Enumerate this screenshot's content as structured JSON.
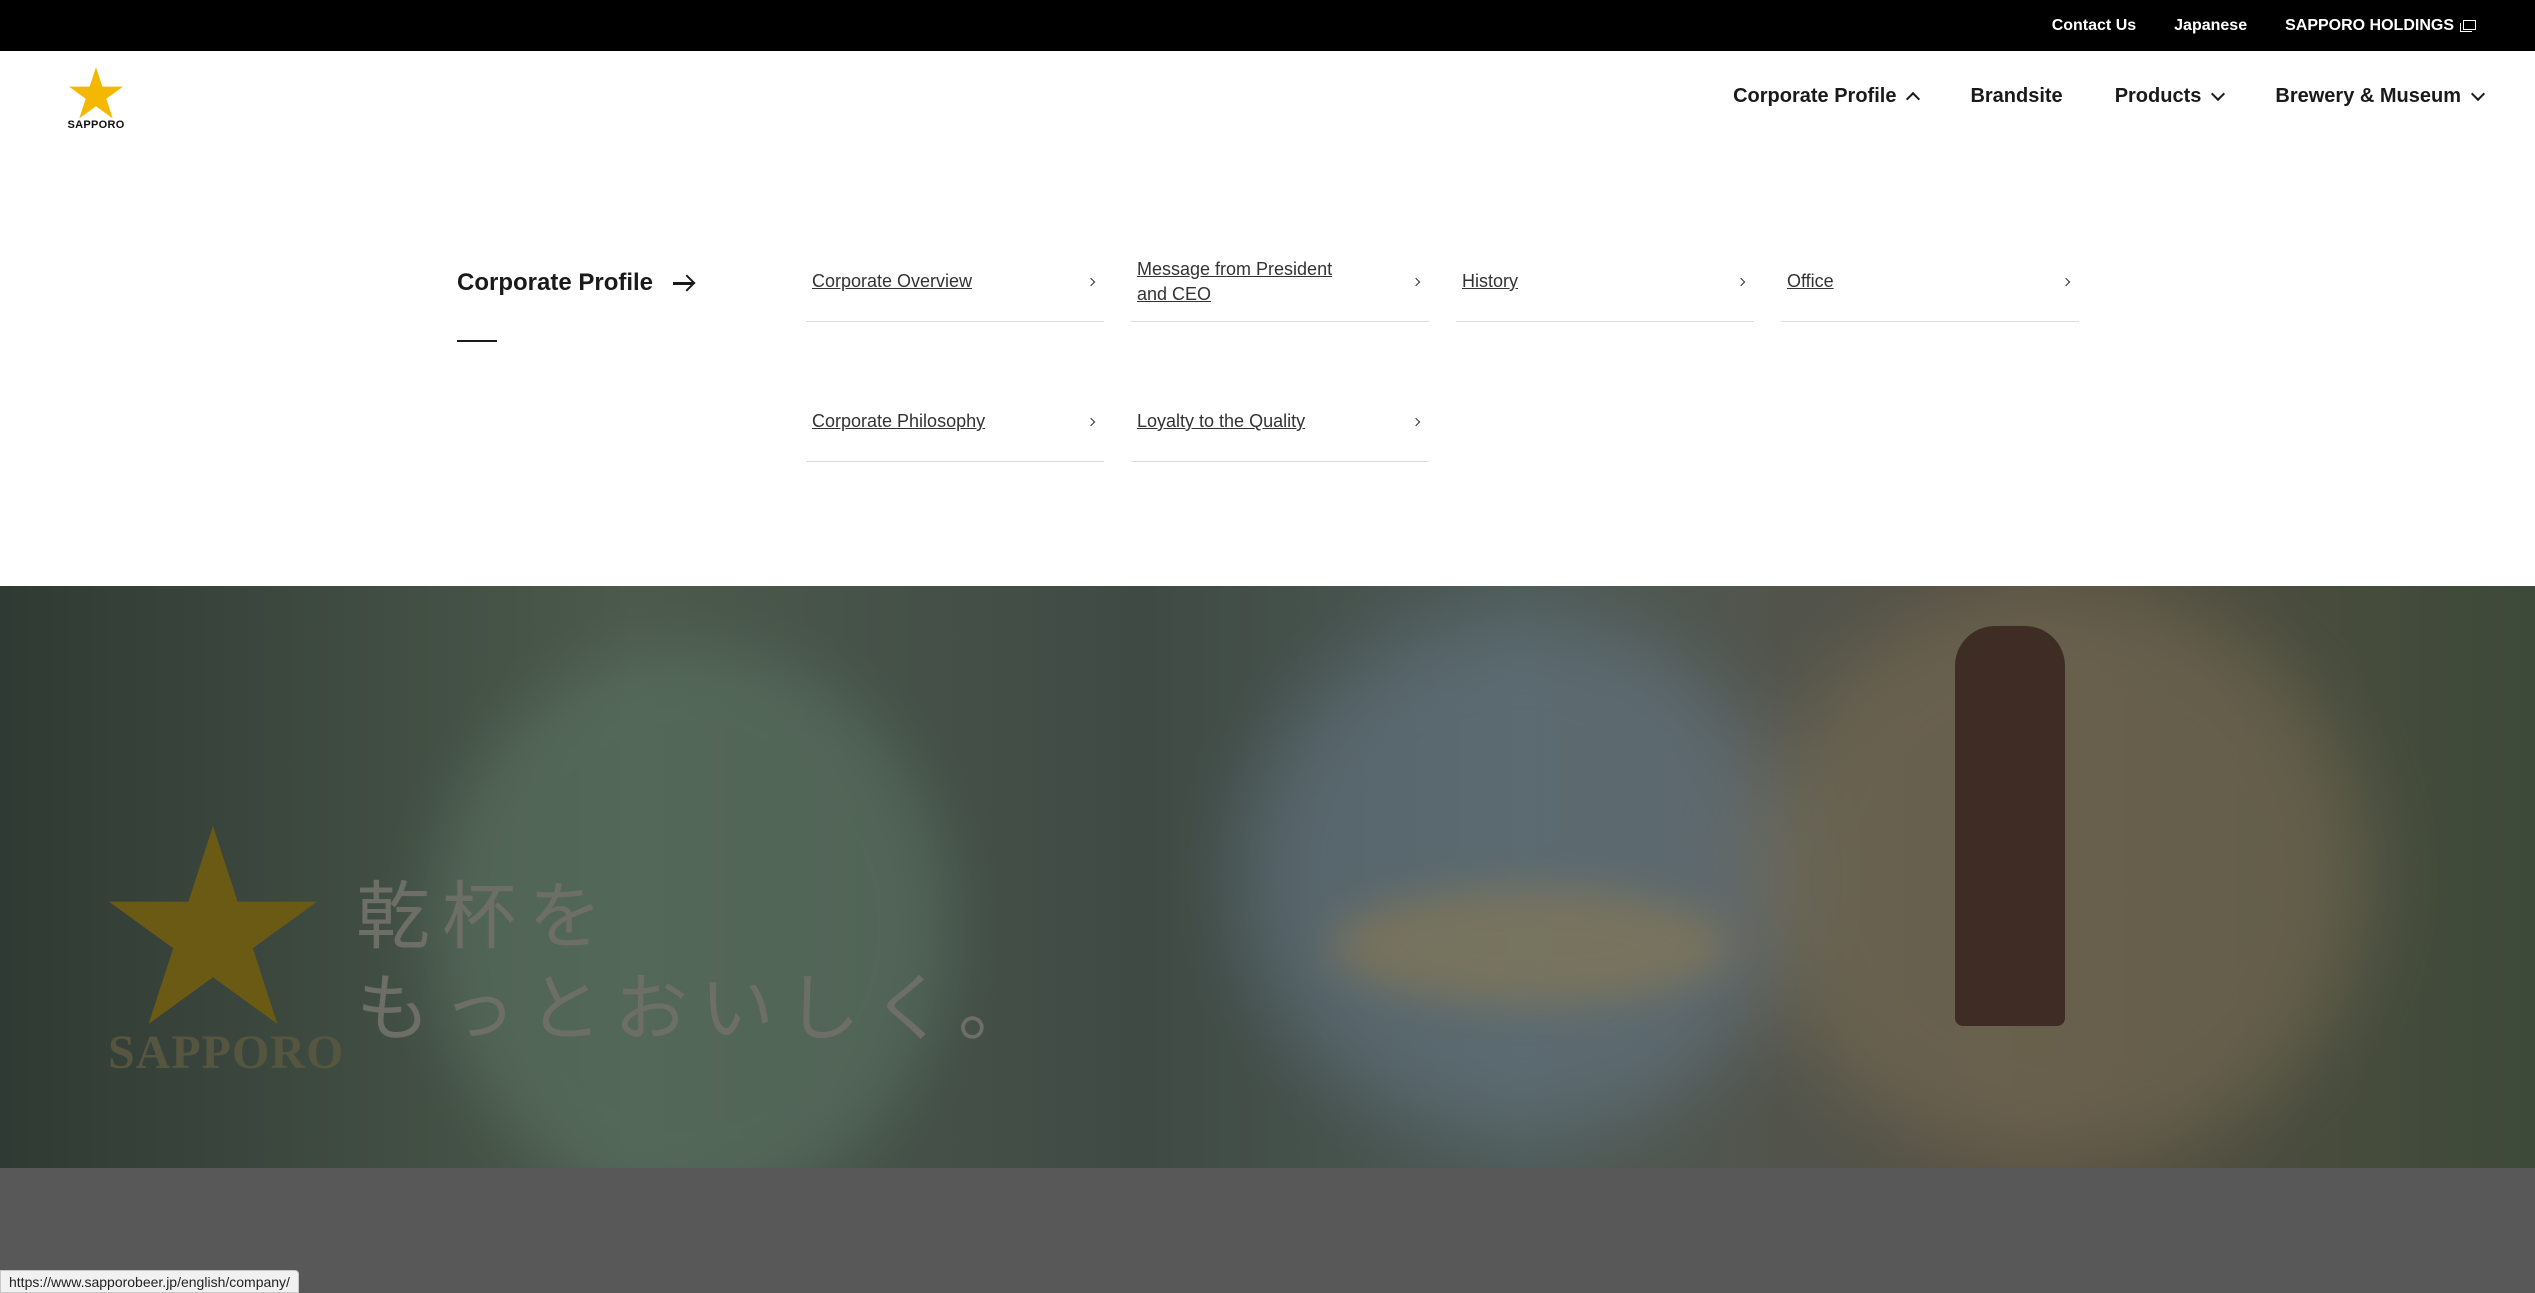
{
  "utility": {
    "contact": "Contact Us",
    "language": "Japanese",
    "holdings": "SAPPORO HOLDINGS"
  },
  "logo": {
    "text": "SAPPORO"
  },
  "nav": {
    "corporate_profile": "Corporate Profile",
    "brandsite": "Brandsite",
    "products": "Products",
    "brewery": "Brewery & Museum"
  },
  "mega": {
    "title": "Corporate Profile",
    "links": [
      "Corporate Overview",
      "Message from President and CEO",
      "History",
      "Office",
      "Corporate Philosophy",
      "Loyalty to the Quality"
    ]
  },
  "hero": {
    "logo_text": "SAPPORO",
    "line1": "乾杯を",
    "line2": "もっとおいしく。"
  },
  "status": {
    "url": "https://www.sapporobeer.jp/english/company/"
  },
  "colors": {
    "brand_gold": "#f5b800",
    "hero_gold": "#6b5a14"
  }
}
